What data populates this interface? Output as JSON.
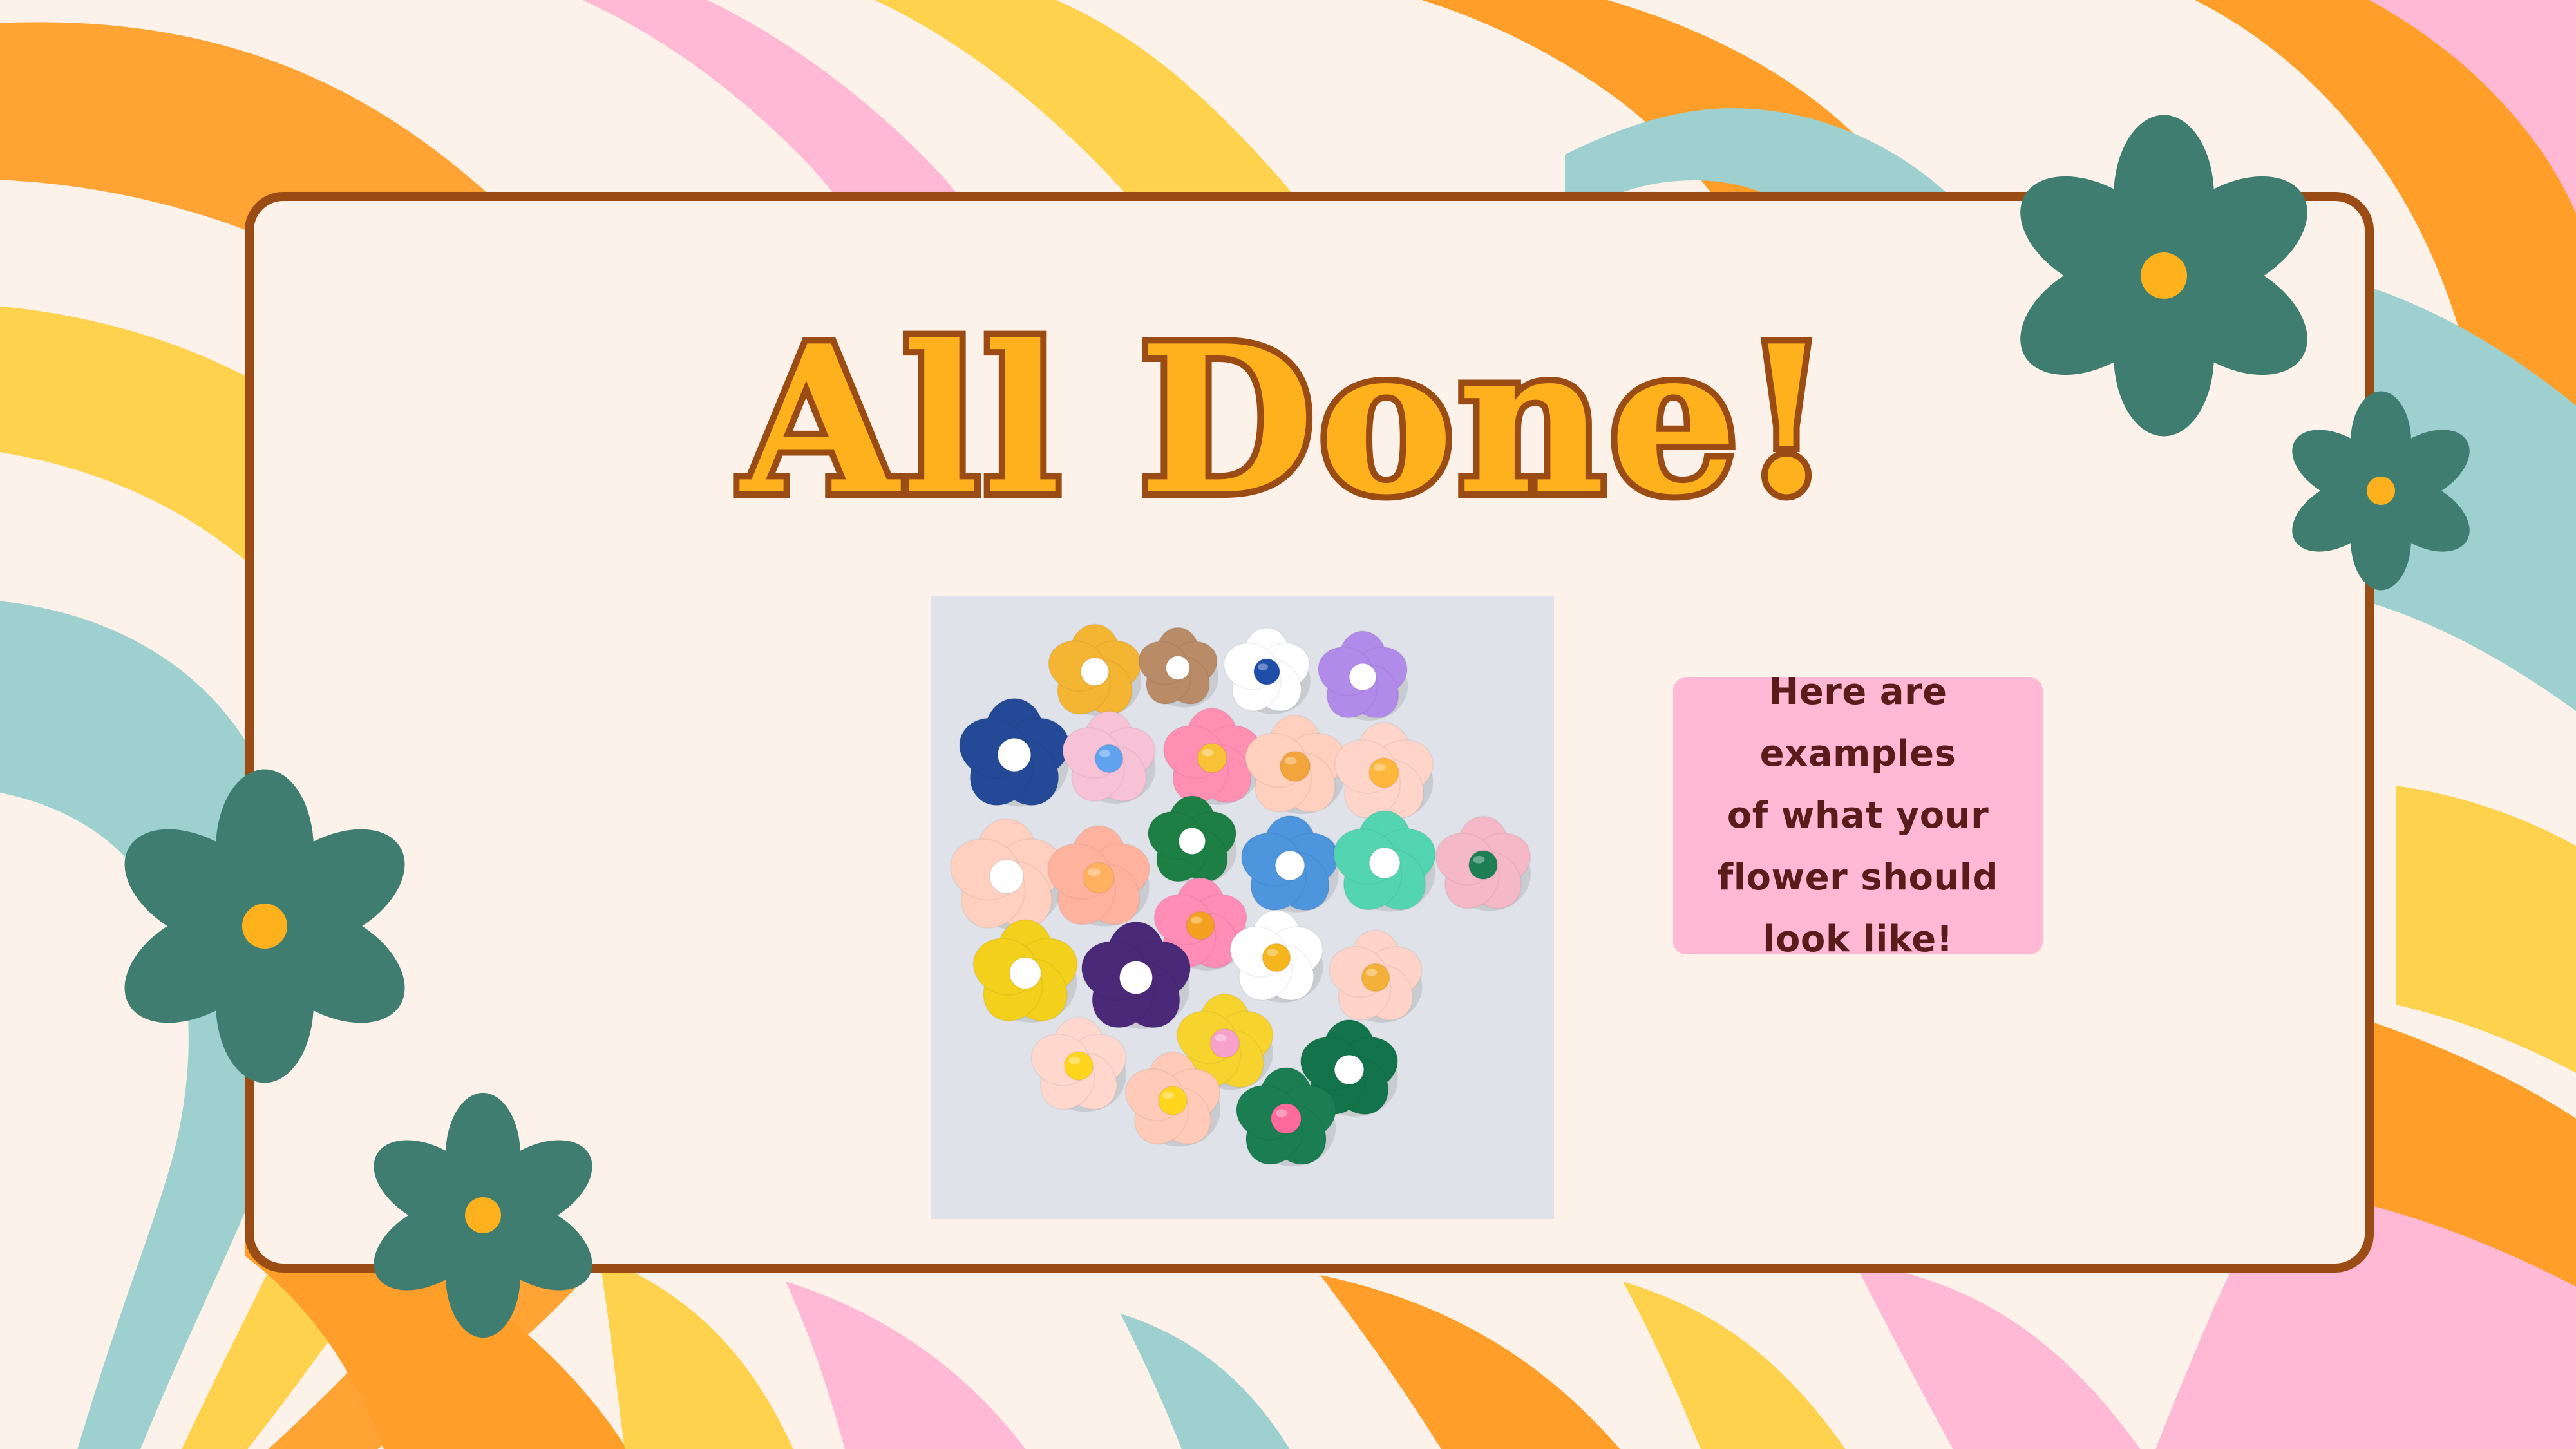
{
  "slide": {
    "title": "All Done!",
    "note": "Here are examples\nof what your\nflower should\nlook like!"
  },
  "palette": {
    "cream": "#fdf2e9",
    "brown": "#9a4c14",
    "yellow": "#fdb21d",
    "orange": "#ff9f2a",
    "pink": "#ffb9d5",
    "teal": "#3f7d70",
    "aqua": "#9ed0cf",
    "note_text": "#5a1b1b"
  },
  "decorations": {
    "flower_icon": "flower-icon"
  },
  "photo": {
    "flower_colors": [
      "#f4b533",
      "#b98b67",
      "#ffffff",
      "#b18be9",
      "#244a97",
      "#f7c2d5",
      "#ff8fb3",
      "#ffd0bd",
      "#ffd5c9",
      "#1d7f44",
      "#ffd0bf",
      "#ffb39f",
      "#ff8db5",
      "#4d95dd",
      "#54d5b1",
      "#f5b8c6",
      "#f3d01b",
      "#4a2a78",
      "#ffffff",
      "#ffd3c7",
      "#f7d42d",
      "#13744b",
      "#ffd7cc",
      "#ffcab7",
      "#1a7e52"
    ]
  }
}
